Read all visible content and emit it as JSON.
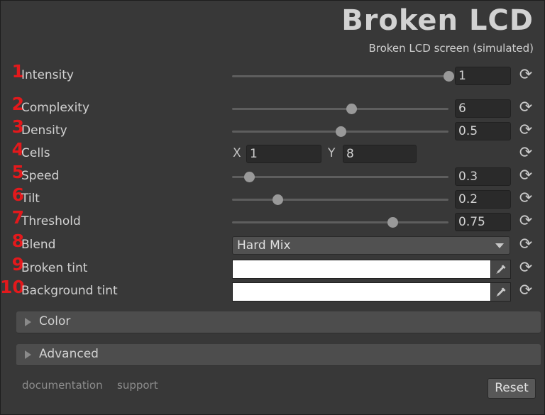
{
  "header": {
    "title": "Broken LCD",
    "subtitle": "Broken LCD screen (simulated)"
  },
  "properties": [
    {
      "num": "1",
      "label": "Intensity",
      "value": "1",
      "slider_fraction": 1.0
    },
    {
      "num": "2",
      "label": "Complexity",
      "value": "6",
      "slider_fraction": 0.55
    },
    {
      "num": "3",
      "label": "Density",
      "value": "0.5",
      "slider_fraction": 0.5
    },
    {
      "num": "4",
      "label": "Cells",
      "x_label": "X",
      "x_value": "1",
      "y_label": "Y",
      "y_value": "8"
    },
    {
      "num": "5",
      "label": "Speed",
      "value": "0.3",
      "slider_fraction": 0.08
    },
    {
      "num": "6",
      "label": "Tilt",
      "value": "0.2",
      "slider_fraction": 0.21
    },
    {
      "num": "7",
      "label": "Threshold",
      "value": "0.75",
      "slider_fraction": 0.74
    },
    {
      "num": "8",
      "label": "Blend",
      "selected": "Hard Mix"
    },
    {
      "num": "9",
      "label": "Broken tint",
      "color": "#ffffff"
    },
    {
      "num": "10",
      "label": "Background tint",
      "color": "#ffffff"
    }
  ],
  "sections": [
    {
      "label": "Color"
    },
    {
      "label": "Advanced"
    }
  ],
  "footer": {
    "documentation": "documentation",
    "support": "support",
    "reset": "Reset"
  },
  "icons": {
    "reset": "refresh-icon",
    "picker": "eyedropper-icon",
    "dropdown": "chevron-down-icon",
    "section": "triangle-right-icon"
  },
  "colors": {
    "background": "#383838",
    "number_accent": "#e3191c",
    "field_bg": "#2a2a2a"
  }
}
